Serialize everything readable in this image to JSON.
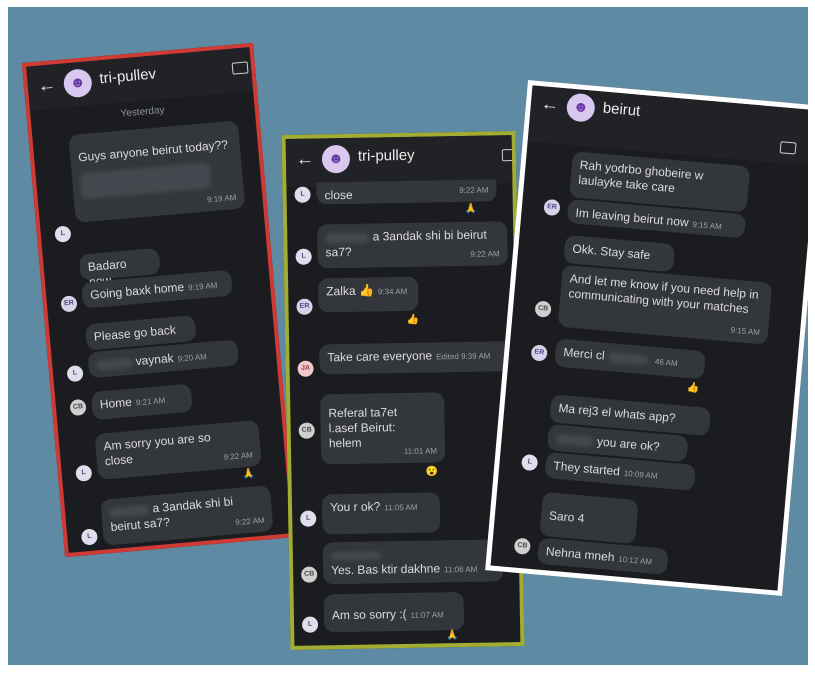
{
  "screenshots": [
    {
      "group_name": "tri-pullev",
      "day_label": "Yesterday",
      "messages": [
        {
          "text": "Guys anyone beirut today??",
          "time": "",
          "avatar": ""
        },
        {
          "text": "",
          "time": "9:19 AM",
          "avatar": "L"
        },
        {
          "text": "Badaro now",
          "time": "",
          "avatar": ""
        },
        {
          "text": "Going baxk home",
          "time": "9:19 AM",
          "avatar": "ER"
        },
        {
          "text": "Please go back",
          "time": "",
          "avatar": ""
        },
        {
          "text": "vaynak",
          "time": "9:20 AM",
          "avatar": "L"
        },
        {
          "text": "Home",
          "time": "9:21 AM",
          "avatar": "CB"
        },
        {
          "text": "Am sorry you are so close",
          "time": "9:22 AM",
          "avatar": "L",
          "reaction": "🙏"
        },
        {
          "text": "a 3andak shi bi beirut sa7?",
          "time": "9:22 AM",
          "avatar": "L"
        }
      ]
    },
    {
      "group_name": "tri-pulley",
      "messages": [
        {
          "text": "close",
          "time": "9:22 AM",
          "avatar": "L",
          "reaction": "🙏"
        },
        {
          "text": "a 3andak shi bi beirut sa7?",
          "time": "9:22 AM",
          "avatar": "L"
        },
        {
          "text": "Zalka 👍",
          "time": "9:34 AM",
          "avatar": "ER",
          "reaction": "👍"
        },
        {
          "text": "Take care everyone",
          "time": "Edited 9:39 AM",
          "avatar": "JA"
        },
        {
          "text": "Referal ta7et l.asef Beirut: helem",
          "time": "11:01 AM",
          "avatar": "CB",
          "reaction": "😮"
        },
        {
          "text": "You r ok?",
          "time": "11:05 AM",
          "avatar": "L"
        },
        {
          "text": "Yes. Bas ktir dakhne",
          "time": "11:06 AM",
          "avatar": "CB"
        },
        {
          "text": "Am so sorry :(",
          "time": "11:07 AM",
          "avatar": "L",
          "reaction": "🙏"
        }
      ]
    },
    {
      "group_name": "beirut",
      "messages": [
        {
          "text": "Rah yodrbo ghobeire w laulayke take care",
          "time": "",
          "avatar": ""
        },
        {
          "text": "Im leaving beirut now",
          "time": "9:15 AM",
          "avatar": "ER"
        },
        {
          "text": "Okk. Stay safe",
          "time": "",
          "avatar": ""
        },
        {
          "text": "And let me know if you need help in communicating with your matches",
          "time": "9:15 AM",
          "avatar": "CB"
        },
        {
          "text": "Merci cl",
          "time": "46 AM",
          "avatar": "ER",
          "reaction": "👍"
        },
        {
          "text": "Ma rej3 el whats app?",
          "time": "",
          "avatar": ""
        },
        {
          "text": "you are ok?",
          "time": "",
          "avatar": ""
        },
        {
          "text": "They started",
          "time": "10:09 AM",
          "avatar": "L"
        },
        {
          "text": "Saro 4",
          "time": "",
          "avatar": ""
        },
        {
          "text": "Nehna mneh",
          "time": "10:12 AM",
          "avatar": "CB"
        }
      ]
    }
  ],
  "icons": {
    "back": "arrow-left-icon",
    "group": "group-avatar-icon",
    "video": "video-call-icon",
    "more": "more-vert-icon"
  },
  "colors": {
    "background": "#5e8ba3",
    "panel1_border": "#cf3a35",
    "panel2_border": "#a2ad32",
    "panel3_border": "#ffffff",
    "chat_bg": "#1b1c1f",
    "bubble": "#33363b"
  }
}
